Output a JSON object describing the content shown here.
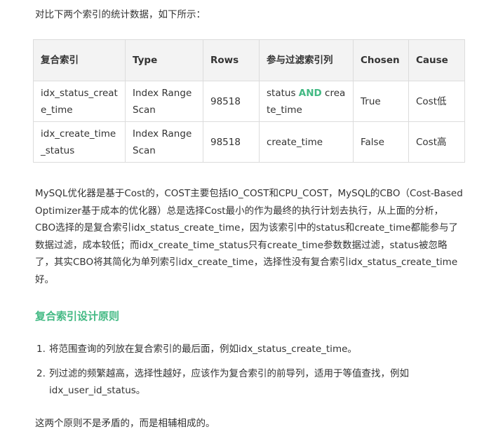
{
  "intro": "对比下两个索引的统计数据，如下所示：",
  "table": {
    "headers": [
      "复合索引",
      "Type",
      "Rows",
      "参与过滤索引列",
      "Chosen",
      "Cause"
    ],
    "rows": [
      {
        "index": "idx_status_create_time",
        "type": "Index Range Scan",
        "rows": "98518",
        "filter_pre": "status ",
        "filter_kw": "AND",
        "filter_post": " create_time",
        "chosen": "True",
        "cause": "Cost低"
      },
      {
        "index": "idx_create_time_status",
        "type": "Index Range Scan",
        "rows": "98518",
        "filter_pre": "create_time",
        "filter_kw": "",
        "filter_post": "",
        "chosen": "False",
        "cause": "Cost高"
      }
    ]
  },
  "paragraph": "MySQL优化器是基于Cost的，COST主要包括IO_COST和CPU_COST，MySQL的CBO（Cost-Based Optimizer基于成本的优化器）总是选择Cost最小的作为最终的执行计划去执行，从上面的分析，CBO选择的是复合索引idx_status_create_time，因为该索引中的status和create_time都能参与了数据过滤，成本较低；而idx_create_time_status只有create_time参数数据过滤，status被忽略了，其实CBO将其简化为单列索引idx_create_time，选择性没有复合索引idx_status_create_time好。",
  "heading": "复合索引设计原则",
  "principles": [
    {
      "num": "1.",
      "text": "将范围查询的列放在复合索引的最后面，例如idx_status_create_time。"
    },
    {
      "num": "2.",
      "text": "列过滤的频繁越高，选择性越好，应该作为复合索引的前导列，适用于等值查找，例如idx_user_id_status。"
    }
  ],
  "closing": "这两个原则不是矛盾的，而是相辅相成的。",
  "colors": {
    "accent": "#42b983",
    "text": "#333333",
    "border": "#dcdcdc",
    "header_bg": "#f3f3f3"
  }
}
